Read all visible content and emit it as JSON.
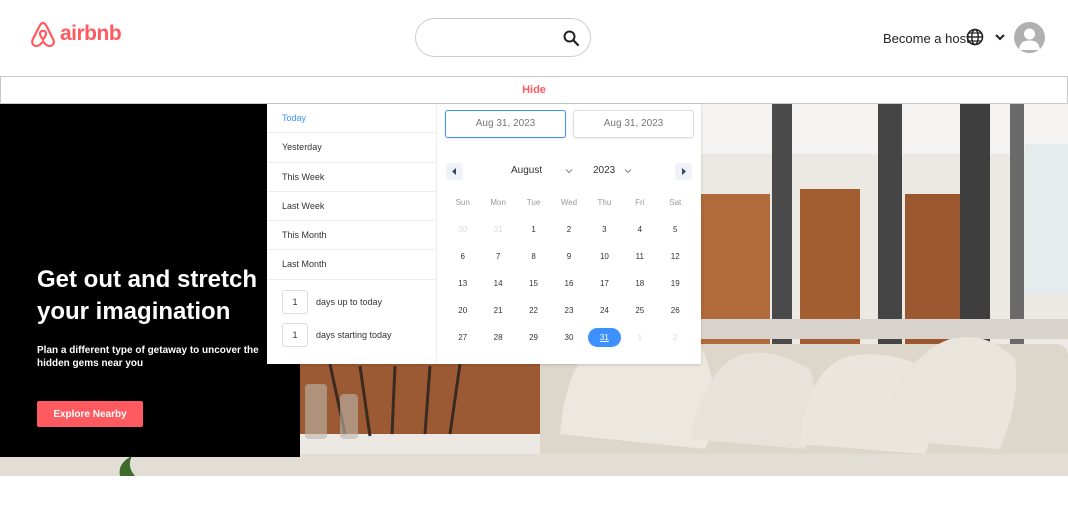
{
  "header": {
    "logo_text": "airbnb",
    "search_placeholder": "",
    "host_link": "Become a host"
  },
  "hide_bar": {
    "label": "Hide"
  },
  "hero": {
    "title": "Get out and stretch your imagination",
    "subtitle": "Plan a different type of getaway to uncover the hidden gems near you",
    "button": "Explore Nearby"
  },
  "picker": {
    "ranges": [
      "Today",
      "Yesterday",
      "This Week",
      "Last Week",
      "This Month",
      "Last Month"
    ],
    "active_range": "Today",
    "input_ranges": [
      {
        "value": "1",
        "label": "days up to today"
      },
      {
        "value": "1",
        "label": "days starting today"
      }
    ],
    "start_date": "Aug 31, 2023",
    "end_date": "Aug 31, 2023",
    "month": "August",
    "year": "2023",
    "weekdays": [
      "Sun",
      "Mon",
      "Tue",
      "Wed",
      "Thu",
      "Fri",
      "Sat"
    ],
    "days": [
      {
        "d": "30",
        "passive": true
      },
      {
        "d": "31",
        "passive": true
      },
      {
        "d": "1"
      },
      {
        "d": "2"
      },
      {
        "d": "3"
      },
      {
        "d": "4"
      },
      {
        "d": "5"
      },
      {
        "d": "6"
      },
      {
        "d": "7"
      },
      {
        "d": "8"
      },
      {
        "d": "9"
      },
      {
        "d": "10"
      },
      {
        "d": "11"
      },
      {
        "d": "12"
      },
      {
        "d": "13"
      },
      {
        "d": "14"
      },
      {
        "d": "15"
      },
      {
        "d": "16"
      },
      {
        "d": "17"
      },
      {
        "d": "18"
      },
      {
        "d": "19"
      },
      {
        "d": "20"
      },
      {
        "d": "21"
      },
      {
        "d": "22"
      },
      {
        "d": "23"
      },
      {
        "d": "24"
      },
      {
        "d": "25"
      },
      {
        "d": "26"
      },
      {
        "d": "27"
      },
      {
        "d": "28"
      },
      {
        "d": "29"
      },
      {
        "d": "30"
      },
      {
        "d": "31",
        "selected": true
      },
      {
        "d": "1",
        "passive": true
      },
      {
        "d": "2",
        "passive": true
      }
    ]
  },
  "colors": {
    "brand": "#ff5a5f",
    "accent": "#3d91ff"
  }
}
